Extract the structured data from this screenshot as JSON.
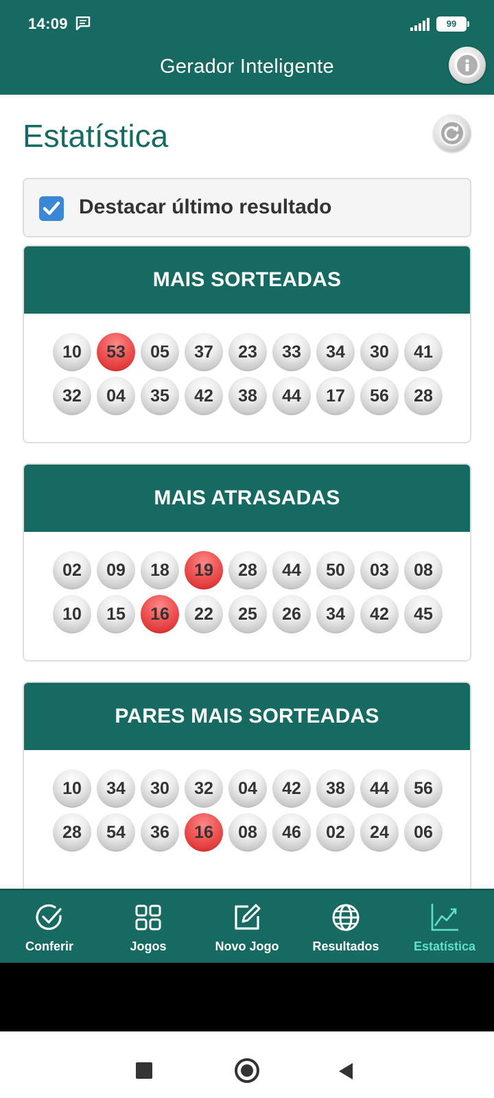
{
  "status_bar": {
    "time": "14:09",
    "battery": "99",
    "icons": [
      "message-icon",
      "signal-icon",
      "battery-icon"
    ]
  },
  "app_bar": {
    "title": "Gerador Inteligente",
    "info_icon": "info-icon"
  },
  "page": {
    "title": "Estatística",
    "refresh_icon": "refresh-icon"
  },
  "highlight_toggle": {
    "label": "Destacar último resultado",
    "checked": true
  },
  "sections": [
    {
      "title": "MAIS SORTEADAS",
      "numbers": [
        "10",
        "53",
        "05",
        "37",
        "23",
        "33",
        "34",
        "30",
        "41",
        "32",
        "04",
        "35",
        "42",
        "38",
        "44",
        "17",
        "56",
        "28"
      ],
      "highlighted": [
        "53"
      ]
    },
    {
      "title": "MAIS ATRASADAS",
      "numbers": [
        "02",
        "09",
        "18",
        "19",
        "28",
        "44",
        "50",
        "03",
        "08",
        "10",
        "15",
        "16",
        "22",
        "25",
        "26",
        "34",
        "42",
        "45"
      ],
      "highlighted": [
        "19",
        "16"
      ]
    },
    {
      "title": "PARES MAIS SORTEADAS",
      "numbers": [
        "10",
        "34",
        "30",
        "32",
        "04",
        "42",
        "38",
        "44",
        "56",
        "28",
        "54",
        "36",
        "16",
        "08",
        "46",
        "02",
        "24",
        "06"
      ],
      "highlighted": [
        "16"
      ]
    }
  ],
  "bottom_nav": {
    "items": [
      {
        "label": "Conferir",
        "icon": "check-circle-icon",
        "active": false
      },
      {
        "label": "Jogos",
        "icon": "grid-icon",
        "active": false
      },
      {
        "label": "Novo Jogo",
        "icon": "edit-icon",
        "active": false
      },
      {
        "label": "Resultados",
        "icon": "globe-icon",
        "active": false
      },
      {
        "label": "Estatística",
        "icon": "chart-icon",
        "active": true
      }
    ]
  },
  "colors": {
    "primary": "#176a61",
    "active_nav": "#5fe0c7",
    "highlight_ball": "#e33d3d",
    "checkbox": "#3a87d6"
  }
}
